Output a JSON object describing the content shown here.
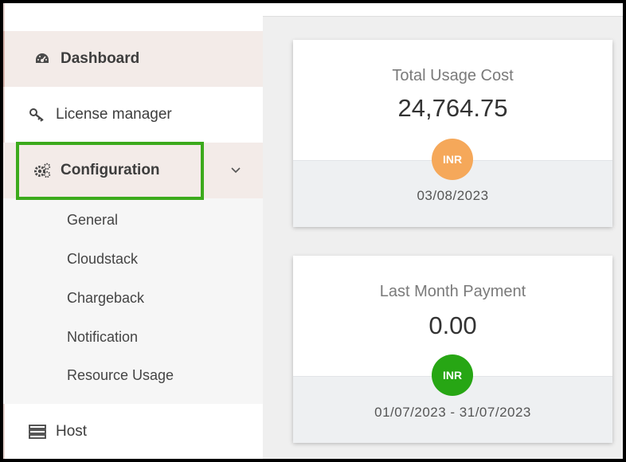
{
  "sidebar": {
    "items": [
      {
        "label": "Dashboard",
        "icon": "dashboard-gauge-icon"
      },
      {
        "label": "License manager",
        "icon": "key-icon"
      },
      {
        "label": "Configuration",
        "icon": "gears-icon",
        "expanded": true
      },
      {
        "label": "Host",
        "icon": "server-icon"
      }
    ],
    "configuration_submenu": [
      "General",
      "Cloudstack",
      "Chargeback",
      "Notification",
      "Resource Usage"
    ]
  },
  "cards": {
    "usage": {
      "title": "Total Usage Cost",
      "value": "24,764.75",
      "currency": "INR",
      "currency_color": "#f5a85a",
      "date": "03/08/2023"
    },
    "payment": {
      "title": "Last Month Payment",
      "value": "0.00",
      "currency": "INR",
      "currency_color": "#27a614",
      "date": "01/07/2023 - 31/07/2023"
    }
  },
  "colors": {
    "highlight": "#3caa1c",
    "active_item_bg": "#f3ebe8"
  }
}
